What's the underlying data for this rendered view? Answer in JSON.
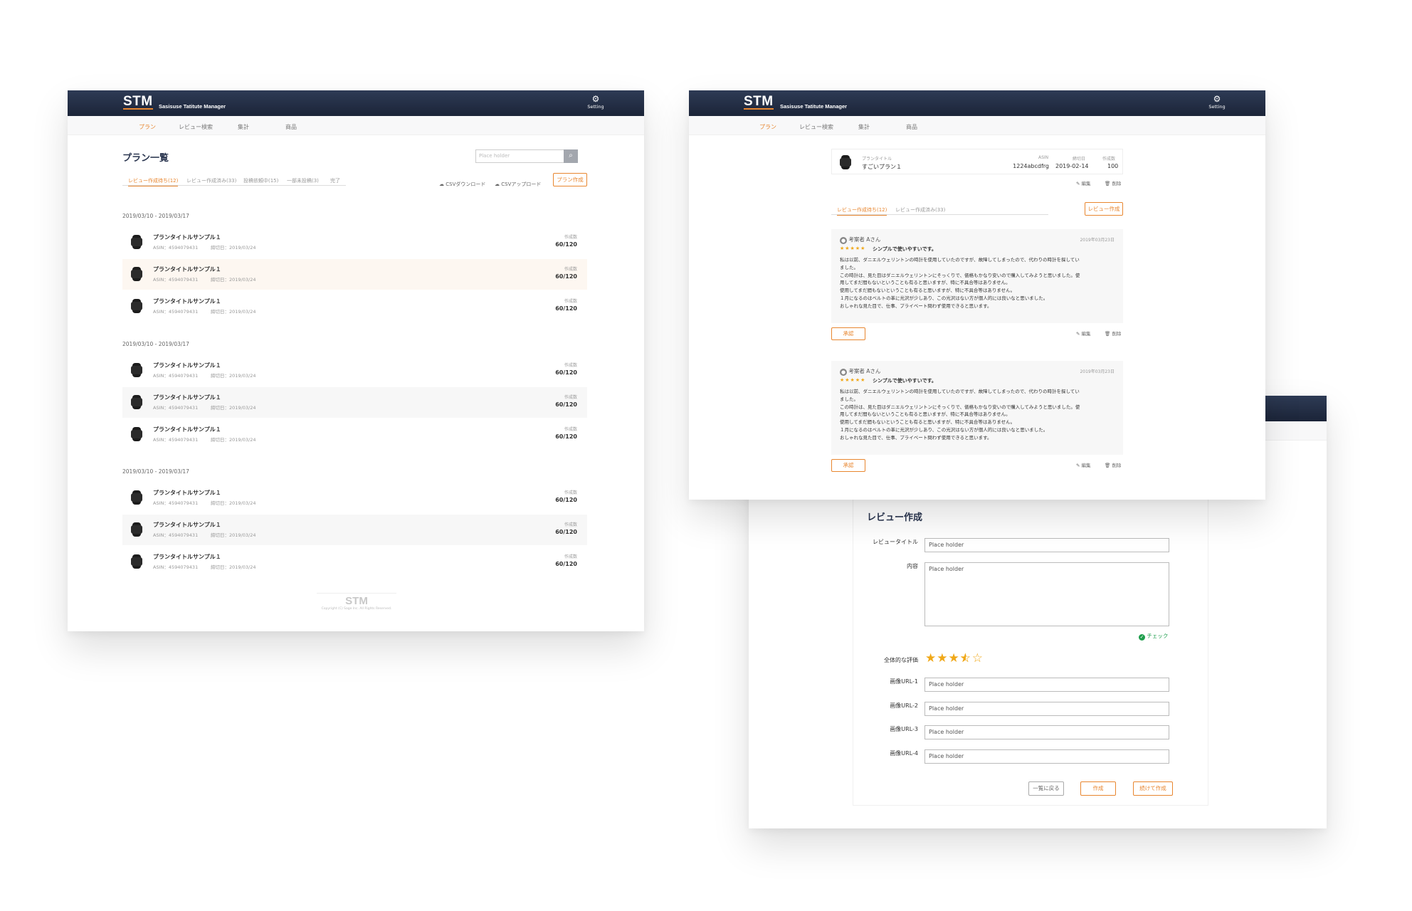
{
  "brand": {
    "logo": "STM",
    "name": "Sasisuse Tatitute Manager",
    "setting": "Setting",
    "gear": "gear-icon",
    "accent": "#e8862f",
    "header_bg": "#1f2a40"
  },
  "nav": [
    "プラン",
    "レビュー検索",
    "集計",
    "商品"
  ],
  "list_page": {
    "title": "プラン一覧",
    "search_placeholder": "Place holder",
    "tabs": [
      "レビュー作成待ち(12)",
      "レビュー作成済み(33)",
      "投稿依頼中(15)",
      "一部未投稿(3)",
      "完了"
    ],
    "csv_download": "CSVダウンロード",
    "csv_upload": "CSVアップロード",
    "create_button": "プラン作成",
    "groups": [
      {
        "date": "2019/03/10 - 2019/03/17",
        "items": [
          {
            "title": "プランタイトルサンプル１",
            "asin": "ASIN：4594079431",
            "deadline": "締切日：2019/03/24",
            "count_label": "作成数",
            "count": "60/120"
          },
          {
            "title": "プランタイトルサンプル１",
            "asin": "ASIN：4594079431",
            "deadline": "締切日：2019/03/24",
            "count_label": "作成数",
            "count": "60/120"
          },
          {
            "title": "プランタイトルサンプル１",
            "asin": "ASIN：4594079431",
            "deadline": "締切日：2019/03/24",
            "count_label": "作成数",
            "count": "60/120"
          }
        ]
      },
      {
        "date": "2019/03/10 - 2019/03/17",
        "items": [
          {
            "title": "プランタイトルサンプル１",
            "asin": "ASIN：4594079431",
            "deadline": "締切日：2019/03/24",
            "count_label": "作成数",
            "count": "60/120"
          },
          {
            "title": "プランタイトルサンプル１",
            "asin": "ASIN：4594079431",
            "deadline": "締切日：2019/03/24",
            "count_label": "作成数",
            "count": "60/120"
          },
          {
            "title": "プランタイトルサンプル１",
            "asin": "ASIN：4594079431",
            "deadline": "締切日：2019/03/24",
            "count_label": "作成数",
            "count": "60/120"
          }
        ]
      },
      {
        "date": "2019/03/10 - 2019/03/17",
        "items": [
          {
            "title": "プランタイトルサンプル１",
            "asin": "ASIN：4594079431",
            "deadline": "締切日：2019/03/24",
            "count_label": "作成数",
            "count": "60/120"
          },
          {
            "title": "プランタイトルサンプル１",
            "asin": "ASIN：4594079431",
            "deadline": "締切日：2019/03/24",
            "count_label": "作成数",
            "count": "60/120"
          },
          {
            "title": "プランタイトルサンプル１",
            "asin": "ASIN：4594079431",
            "deadline": "締切日：2019/03/24",
            "count_label": "作成数",
            "count": "60/120"
          }
        ]
      }
    ],
    "footer_logo": "STM",
    "copyright": "Copyright (C) Sage Inc. All Rights Reserved."
  },
  "detail_page": {
    "plan_title_label": "プランタイトル",
    "plan_title": "すごいプラン１",
    "asin_label": "ASIN",
    "asin": "1224abcdfrg",
    "deadline_label": "締切日",
    "deadline": "2019-02-14",
    "count_label": "作成数",
    "count": "100",
    "edit": "編集",
    "delete": "削除",
    "tabs": [
      "レビュー作成待ち(12)",
      "レビュー作成済み(33)"
    ],
    "create_review": "レビュー作成",
    "reviews": [
      {
        "author": "考案者 Aさん",
        "date": "2019年03月23日",
        "stars": "★★★★★",
        "headline": "シンプルで使いやすいです。",
        "body": [
          "私は以前、ダニエルウェリントンの時計を使用していたのですが、故障してしまったので、代わりの時計を探してい",
          "ました。",
          "この時計は、見た目はダニエルウェリントンにそっくりで、価格もかなり安いので購入してみようと思いました。使",
          "用してまだ間もないということも有ると思いますが、特に不具合等はありません。",
          "使用してまだ間もないということも有ると思いますが、特に不具合等はありません。",
          "１月になるのはベルトの革に光沢が少しあり、この光沢はない方が個人的には良いなと思いました。",
          "おしゃれな見た目で、仕事、プライベート問わず使用できると思います。"
        ],
        "approve": "承認"
      },
      {
        "author": "考案者 Aさん",
        "date": "2019年03月23日",
        "stars": "★★★★★",
        "headline": "シンプルで使いやすいです。",
        "body": [
          "私は以前、ダニエルウェリントンの時計を使用していたのですが、故障してしまったので、代わりの時計を探してい",
          "ました。",
          "この時計は、見た目はダニエルウェリントンにそっくりで、価格もかなり安いので購入してみようと思いました。使",
          "用してまだ間もないということも有ると思いますが、特に不具合等はありません。",
          "使用してまだ間もないということも有ると思いますが、特に不具合等はありません。",
          "１月になるのはベルトの革に光沢が少しあり、この光沢はない方が個人的には良いなと思いました。",
          "おしゃれな見た目で、仕事、プライベート問わず使用できると思います。"
        ],
        "approve": "承認"
      }
    ]
  },
  "form_page": {
    "title": "レビュー作成",
    "review_title_label": "レビュータイトル",
    "content_label": "内容",
    "placeholder": "Place holder",
    "check": "チェック",
    "rating_label": "全体的な評価",
    "rating": 3.5,
    "rating_max": 5,
    "image_url_labels": [
      "画像URL-1",
      "画像URL-2",
      "画像URL-3",
      "画像URL-4"
    ],
    "back_button": "一覧に戻る",
    "create_button": "作成",
    "continue_button": "続けて作成"
  }
}
